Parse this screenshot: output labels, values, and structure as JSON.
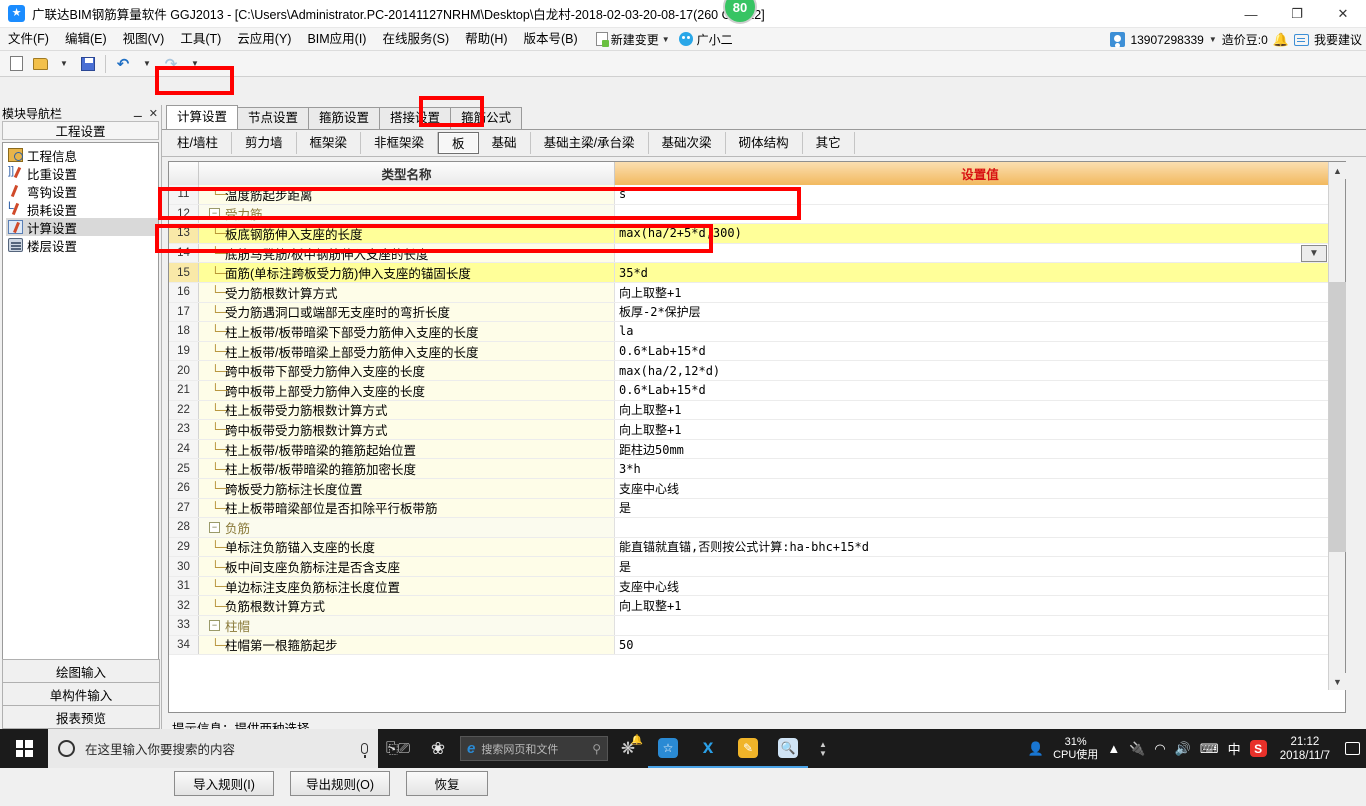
{
  "window": {
    "title": "广联达BIM钢筋算量软件 GGJ2013 - [C:\\Users\\Administrator.PC-20141127NRHM\\Desktop\\白龙村-2018-02-03-20-08-17(260   GGJ12]",
    "score_badge": "80",
    "minimize": "—",
    "maximize": "❐",
    "close": "✕",
    "logo": "app-logo"
  },
  "menu": {
    "items": [
      "文件(F)",
      "编辑(E)",
      "视图(V)",
      "工具(T)",
      "云应用(Y)",
      "BIM应用(I)",
      "在线服务(S)",
      "帮助(H)",
      "版本号(B)"
    ],
    "new_change": "新建变更",
    "assistant": "广小二"
  },
  "account": {
    "phone": "13907298339",
    "beans": "造价豆:0",
    "suggest": "我要建议"
  },
  "toolbar": {
    "new": "new-file-icon",
    "open": "open-folder-icon",
    "save": "save-icon",
    "undo": "undo-icon",
    "redo": "redo-icon"
  },
  "sidebar": {
    "header": "模块导航栏",
    "pin": "pin-icon",
    "close": "close-icon",
    "title": "工程设置",
    "items": [
      {
        "label": "工程信息",
        "icon": "project-info-icon"
      },
      {
        "label": "比重设置",
        "icon": "weight-settings-icon"
      },
      {
        "label": "弯钩设置",
        "icon": "hook-settings-icon"
      },
      {
        "label": "损耗设置",
        "icon": "loss-settings-icon"
      },
      {
        "label": "计算设置",
        "icon": "calc-settings-icon"
      },
      {
        "label": "楼层设置",
        "icon": "floor-settings-icon"
      }
    ],
    "buttons": [
      "绘图输入",
      "单构件输入",
      "报表预览"
    ]
  },
  "tabs_primary": [
    "计算设置",
    "节点设置",
    "箍筋设置",
    "搭接设置",
    "箍筋公式"
  ],
  "tabs_primary_active": "计算设置",
  "tabs_secondary": [
    "柱/墙柱",
    "剪力墙",
    "框架梁",
    "非框架梁",
    "板",
    "基础",
    "基础主梁/承台梁",
    "基础次梁",
    "砌体结构",
    "其它"
  ],
  "tabs_secondary_active": "板",
  "grid": {
    "headers": [
      "",
      "类型名称",
      "设置值"
    ],
    "rows": [
      {
        "idx": "11",
        "kind": "leaf",
        "name": "温度筋起步距离",
        "value": "s",
        "selected": false
      },
      {
        "idx": "12",
        "kind": "group",
        "name": "受力筋",
        "value": "",
        "selected": false
      },
      {
        "idx": "13",
        "kind": "leaf",
        "name": "板底钢筋伸入支座的长度",
        "value": "max(ha/2+5*d,300)",
        "selected": true
      },
      {
        "idx": "14",
        "kind": "leaf",
        "name": "底筋马凳筋/板中钢筋伸入支座的长度",
        "value": "",
        "selected": false,
        "has_dropdown": true
      },
      {
        "idx": "15",
        "kind": "leaf",
        "name": "面筋(单标注跨板受力筋)伸入支座的锚固长度",
        "value": "35*d",
        "selected": true
      },
      {
        "idx": "16",
        "kind": "leaf",
        "name": "受力筋根数计算方式",
        "value": "向上取整+1",
        "selected": false
      },
      {
        "idx": "17",
        "kind": "leaf",
        "name": "受力筋遇洞口或端部无支座时的弯折长度",
        "value": "板厚-2*保护层",
        "selected": false
      },
      {
        "idx": "18",
        "kind": "leaf",
        "name": "柱上板带/板带暗梁下部受力筋伸入支座的长度",
        "value": "la",
        "selected": false
      },
      {
        "idx": "19",
        "kind": "leaf",
        "name": "柱上板带/板带暗梁上部受力筋伸入支座的长度",
        "value": "0.6*Lab+15*d",
        "selected": false
      },
      {
        "idx": "20",
        "kind": "leaf",
        "name": "跨中板带下部受力筋伸入支座的长度",
        "value": "max(ha/2,12*d)",
        "selected": false
      },
      {
        "idx": "21",
        "kind": "leaf",
        "name": "跨中板带上部受力筋伸入支座的长度",
        "value": "0.6*Lab+15*d",
        "selected": false
      },
      {
        "idx": "22",
        "kind": "leaf",
        "name": "柱上板带受力筋根数计算方式",
        "value": "向上取整+1",
        "selected": false
      },
      {
        "idx": "23",
        "kind": "leaf",
        "name": "跨中板带受力筋根数计算方式",
        "value": "向上取整+1",
        "selected": false
      },
      {
        "idx": "24",
        "kind": "leaf",
        "name": "柱上板带/板带暗梁的箍筋起始位置",
        "value": "距柱边50mm",
        "selected": false
      },
      {
        "idx": "25",
        "kind": "leaf",
        "name": "柱上板带/板带暗梁的箍筋加密长度",
        "value": "3*h",
        "selected": false
      },
      {
        "idx": "26",
        "kind": "leaf",
        "name": "跨板受力筋标注长度位置",
        "value": "支座中心线",
        "selected": false
      },
      {
        "idx": "27",
        "kind": "leaf",
        "name": "柱上板带暗梁部位是否扣除平行板带筋",
        "value": "是",
        "selected": false
      },
      {
        "idx": "28",
        "kind": "group",
        "name": "负筋",
        "value": "",
        "selected": false
      },
      {
        "idx": "29",
        "kind": "leaf",
        "name": "单标注负筋锚入支座的长度",
        "value": "能直锚就直锚,否则按公式计算:ha-bhc+15*d",
        "selected": false
      },
      {
        "idx": "30",
        "kind": "leaf",
        "name": "板中间支座负筋标注是否含支座",
        "value": "是",
        "selected": false
      },
      {
        "idx": "31",
        "kind": "leaf",
        "name": "单边标注支座负筋标注长度位置",
        "value": "支座中心线",
        "selected": false
      },
      {
        "idx": "32",
        "kind": "leaf",
        "name": "负筋根数计算方式",
        "value": "向上取整+1",
        "selected": false
      },
      {
        "idx": "33",
        "kind": "group",
        "name": "柱帽",
        "value": "",
        "selected": false
      },
      {
        "idx": "34",
        "kind": "leaf",
        "name": "柱帽第一根箍筋起步",
        "value": "50",
        "selected": false
      }
    ]
  },
  "hint": "提示信息：提供两种选择。",
  "footer_buttons": [
    "导入规则(I)",
    "导出规则(O)",
    "恢复"
  ],
  "taskbar": {
    "start": "windows-start-icon",
    "search_placeholder": "在这里输入你要搜索的内容",
    "mic": "microphone-icon",
    "task_view": "task-view-icon",
    "ie_search_placeholder": "搜索网页和文件",
    "cpu_percent": "31%",
    "cpu_label": "CPU使用",
    "ime": "中",
    "time": "21:12",
    "date": "2018/11/7"
  },
  "annotations": {
    "color": "#ff0000",
    "boxes": [
      "tab-计算设置",
      "tab-板",
      "row-13",
      "row-15"
    ]
  }
}
